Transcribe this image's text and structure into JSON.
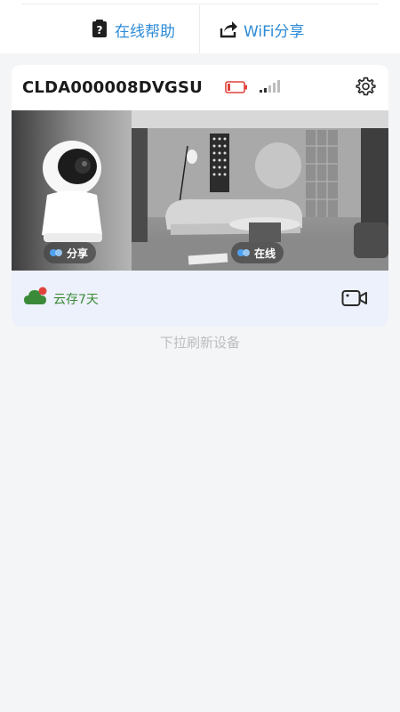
{
  "topbar": {
    "help_label": "在线帮助",
    "share_label": "WiFi分享",
    "help_icon": "question-document-icon",
    "share_icon": "share-arrow-icon",
    "accent": "#2e8bd6"
  },
  "device": {
    "name": "CLDA000008DVGSU",
    "battery_icon": "battery-low-icon",
    "signal_icon": "signal-bars-icon",
    "settings_icon": "gear-icon",
    "share_badge": "分享",
    "status_badge": "在线",
    "cloud_storage": "云存7天",
    "cloud_icon": "cloud-icon",
    "record_icon": "video-camera-icon"
  },
  "hint": {
    "pull_refresh": "下拉刷新设备"
  },
  "colors": {
    "battery_red": "#e0423b",
    "cloud_green": "#3b8a3a",
    "footer_bg": "#edf1fb"
  }
}
